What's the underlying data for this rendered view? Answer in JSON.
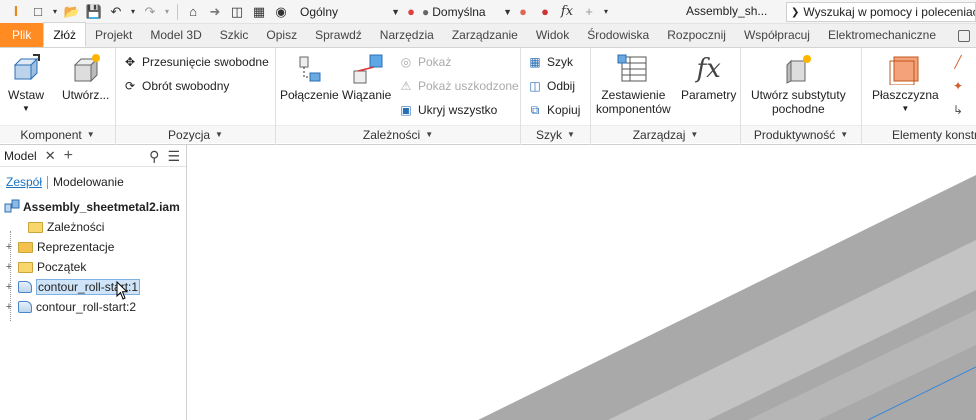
{
  "qat": {
    "style_value": "Ogólny",
    "appearance_value": "Domyślna",
    "doc_title": "Assembly_sh...",
    "search_placeholder": "Wyszukaj w pomocy i poleceniach..."
  },
  "tabs": [
    "Plik",
    "Złóż",
    "Projekt",
    "Model 3D",
    "Szkic",
    "Opisz",
    "Sprawdź",
    "Narzędzia",
    "Zarządzanie",
    "Widok",
    "Środowiska",
    "Rozpocznij",
    "Współpracuj",
    "Elektromechaniczne"
  ],
  "active_tab": "Złóż",
  "ribbon": {
    "komponent": {
      "title": "Komponent",
      "insert": "Wstaw",
      "create": "Utwórz..."
    },
    "pozycja": {
      "title": "Pozycja",
      "free_move": "Przesunięcie swobodne",
      "free_rotate": "Obrót swobodny"
    },
    "zaleznosci": {
      "title": "Zależności",
      "joint": "Połączenie",
      "constrain": "Wiązanie",
      "show": "Pokaż",
      "show_sick": "Pokaż uszkodzone",
      "hide_all": "Ukryj wszystko"
    },
    "szyk": {
      "title": "Szyk",
      "pattern": "Szyk",
      "mirror": "Odbij",
      "copy": "Kopiuj"
    },
    "zarzadzaj": {
      "title": "Zarządzaj",
      "bom_line1": "Zestawienie",
      "bom_line2": "komponentów",
      "params": "Parametry"
    },
    "produktywnosc": {
      "title": "Produktywność",
      "substitute_line1": "Utwórz substytuty",
      "substitute_line2": "pochodne"
    },
    "elementy": {
      "title": "Elementy konstrukcyjne",
      "plane": "Płaszczyzna"
    }
  },
  "browser": {
    "title": "Model",
    "tab_assembly": "Zespół",
    "tab_modeling": "Modelowanie",
    "root": "Assembly_sheetmetal2.iam",
    "items": [
      {
        "label": "Zależności",
        "expandable": false,
        "icon": "folder"
      },
      {
        "label": "Reprezentacje",
        "expandable": true,
        "icon": "folder-rep"
      },
      {
        "label": "Początek",
        "expandable": true,
        "icon": "folder"
      },
      {
        "label": "contour_roll-start:1",
        "expandable": true,
        "icon": "part",
        "selected": true
      },
      {
        "label": "contour_roll-start:2",
        "expandable": true,
        "icon": "part",
        "selected": false
      }
    ]
  },
  "colors": {
    "file_tab": "#ff8b22",
    "selection": "#cfe4f8",
    "link": "#1a74c4"
  }
}
